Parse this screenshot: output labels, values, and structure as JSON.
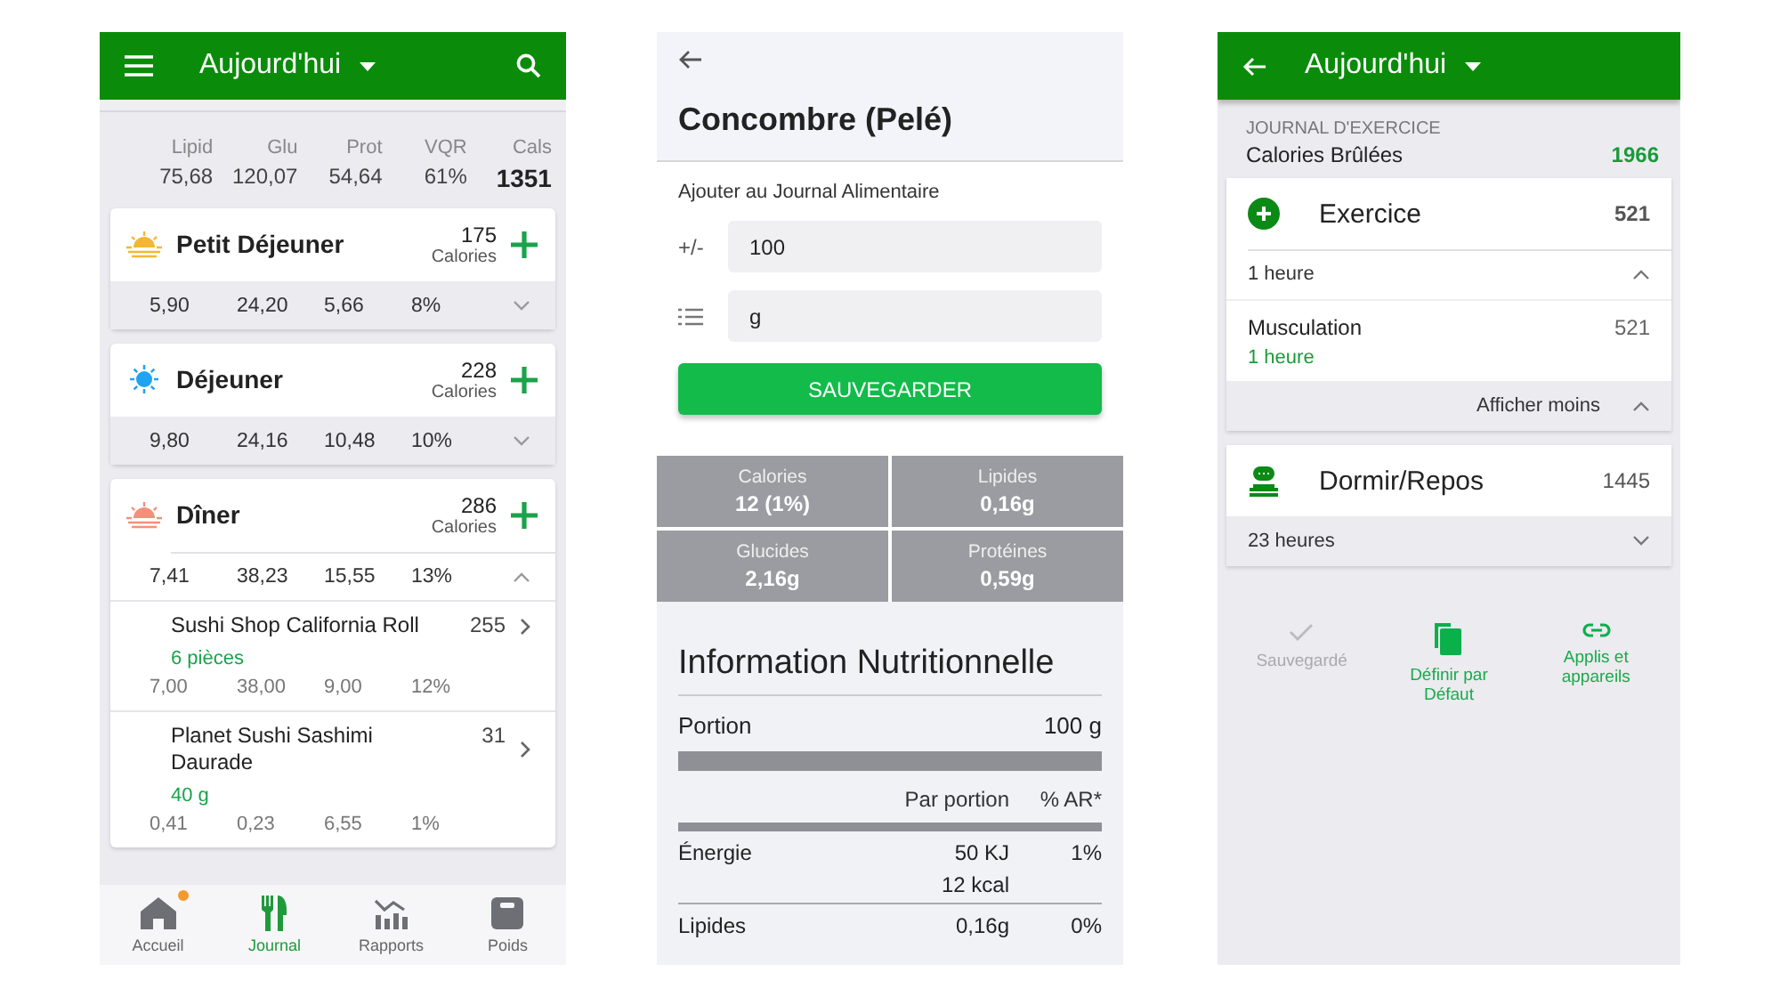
{
  "journal": {
    "header": {
      "title": "Aujourd'hui"
    },
    "summary": [
      {
        "label": "Lipid",
        "value": "75,68"
      },
      {
        "label": "Glu",
        "value": "120,07"
      },
      {
        "label": "Prot",
        "value": "54,64"
      },
      {
        "label": "VQR",
        "value": "61%"
      },
      {
        "label": "Cals",
        "value": "1351",
        "kind": "total"
      }
    ],
    "meals": [
      {
        "name": "Petit Déjeuner",
        "calories": "175",
        "unit": "Calories",
        "macros": [
          "5,90",
          "24,20",
          "5,66",
          "8%"
        ],
        "expanded": false
      },
      {
        "name": "Déjeuner",
        "calories": "228",
        "unit": "Calories",
        "macros": [
          "9,80",
          "24,16",
          "10,48",
          "10%"
        ],
        "expanded": false
      },
      {
        "name": "Dîner",
        "calories": "286",
        "unit": "Calories",
        "macros": [
          "7,41",
          "38,23",
          "15,55",
          "13%"
        ],
        "expanded": true,
        "items": [
          {
            "name": "Sushi Shop California Roll",
            "calories": "255",
            "portion": "6 pièces",
            "macros": [
              "7,00",
              "38,00",
              "9,00",
              "12%"
            ]
          },
          {
            "name": "Planet Sushi Sashimi Daurade",
            "calories": "31",
            "portion": "40  g",
            "macros": [
              "0,41",
              "0,23",
              "6,55",
              "1%"
            ]
          }
        ]
      }
    ],
    "nav": [
      {
        "label": "Accueil",
        "selected": false,
        "badge": true
      },
      {
        "label": "Journal",
        "selected": true,
        "badge": false
      },
      {
        "label": "Rapports",
        "selected": false,
        "badge": false
      },
      {
        "label": "Poids",
        "selected": false,
        "badge": false
      }
    ]
  },
  "food": {
    "title": "Concombre (Pelé)",
    "subtitle": "Ajouter au Journal Alimentaire",
    "quantity": {
      "label": "+/-",
      "value": "100"
    },
    "unit": {
      "value": "g"
    },
    "save_button": "SAUVEGARDER",
    "stats": [
      {
        "label": "Calories",
        "value": "12 (1%)"
      },
      {
        "label": "Lipides",
        "value": "0,16g"
      },
      {
        "label": "Glucides",
        "value": "2,16g"
      },
      {
        "label": "Protéines",
        "value": "0,59g"
      }
    ],
    "nutrition": {
      "title": "Information Nutritionnelle",
      "portion_label": "Portion",
      "portion_value": "100  g",
      "column_1": "Par portion",
      "column_2": "% AR*",
      "rows": [
        {
          "name": "Énergie",
          "values": [
            "50 KJ",
            "12 kcal"
          ],
          "percent": "1%"
        },
        {
          "name": "Lipides",
          "values": [
            "0,16g"
          ],
          "percent": "0%"
        }
      ]
    }
  },
  "exercise": {
    "header": {
      "title": "Aujourd'hui"
    },
    "section": "JOURNAL D'EXERCICE",
    "burned_label": "Calories Brûlées",
    "burned_value": "1966",
    "cards": [
      {
        "title": "Exercice",
        "value": "521",
        "highlight": true,
        "summary": "1 heure",
        "expanded": true,
        "items": [
          {
            "name": "Musculation",
            "value": "521",
            "duration": "1 heure"
          }
        ],
        "toggle": "Afficher moins"
      },
      {
        "title": "Dormir/Repos",
        "value": "1445",
        "highlight": false,
        "summary": "23 heures",
        "expanded": false
      }
    ],
    "actions": [
      {
        "label": "Sauvegardé",
        "disabled": true
      },
      {
        "label": "Définir par Défaut",
        "disabled": false
      },
      {
        "label": "Applis et appareils",
        "disabled": false
      }
    ]
  }
}
